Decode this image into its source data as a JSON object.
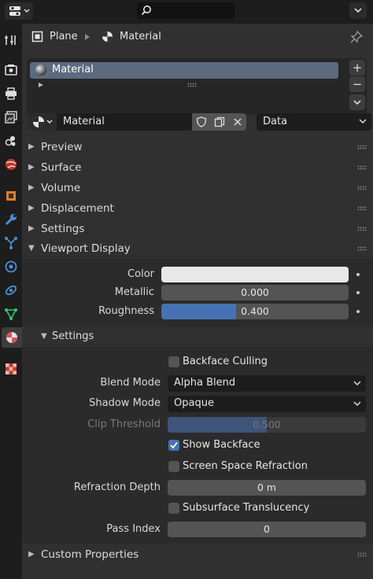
{
  "topbar": {
    "editor_type_icon": "properties-editor-icon",
    "search": {
      "placeholder": ""
    }
  },
  "sidebar": {
    "tabs": [
      {
        "name": "tool-tab",
        "icon": "tool-icon"
      },
      {
        "name": "render-tab",
        "icon": "render-icon"
      },
      {
        "name": "output-tab",
        "icon": "output-printer-icon"
      },
      {
        "name": "view-layer-tab",
        "icon": "view-layer-icon"
      },
      {
        "name": "scene-tab",
        "icon": "scene-icon"
      },
      {
        "name": "world-tab",
        "icon": "world-icon"
      },
      {
        "name": "object-tab",
        "icon": "object-icon"
      },
      {
        "name": "modifiers-tab",
        "icon": "wrench-icon"
      },
      {
        "name": "particles-tab",
        "icon": "particles-icon"
      },
      {
        "name": "physics-tab",
        "icon": "physics-icon"
      },
      {
        "name": "constraints-tab",
        "icon": "constraints-icon"
      },
      {
        "name": "data-tab",
        "icon": "mesh-data-icon"
      },
      {
        "name": "material-tab",
        "icon": "material-icon"
      },
      {
        "name": "texture-tab",
        "icon": "texture-icon"
      }
    ]
  },
  "breadcrumb": {
    "object": "Plane",
    "material": "Material"
  },
  "slots": {
    "items": [
      {
        "label": "Material"
      }
    ],
    "add": "+",
    "remove": "−"
  },
  "material": {
    "name": "Material",
    "link": "Data"
  },
  "panels": {
    "preview": "Preview",
    "surface": "Surface",
    "volume": "Volume",
    "displacement": "Displacement",
    "settings": "Settings",
    "viewport_display": "Viewport Display",
    "custom_properties": "Custom Properties"
  },
  "viewport_display": {
    "color_label": "Color",
    "color_value": "#e8e8e8",
    "metallic_label": "Metallic",
    "metallic_value": "0.000",
    "roughness_label": "Roughness",
    "roughness_value": "0.400",
    "roughness_fraction": 0.4,
    "settings_label": "Settings"
  },
  "settings": {
    "backface_culling": "Backface Culling",
    "blend_mode_label": "Blend Mode",
    "blend_mode_value": "Alpha Blend",
    "shadow_mode_label": "Shadow Mode",
    "shadow_mode_value": "Opaque",
    "clip_threshold_label": "Clip Threshold",
    "clip_threshold_value": "0.500",
    "clip_threshold_fraction": 0.5,
    "show_backface": "Show Backface",
    "screen_space_refraction": "Screen Space Refraction",
    "refraction_depth_label": "Refraction Depth",
    "refraction_depth_value": "0 m",
    "subsurface_translucency": "Subsurface Translucency",
    "pass_index_label": "Pass Index",
    "pass_index_value": "0"
  },
  "colors": {
    "accent": "#4772b3",
    "active_slot": "#5c6a80"
  }
}
